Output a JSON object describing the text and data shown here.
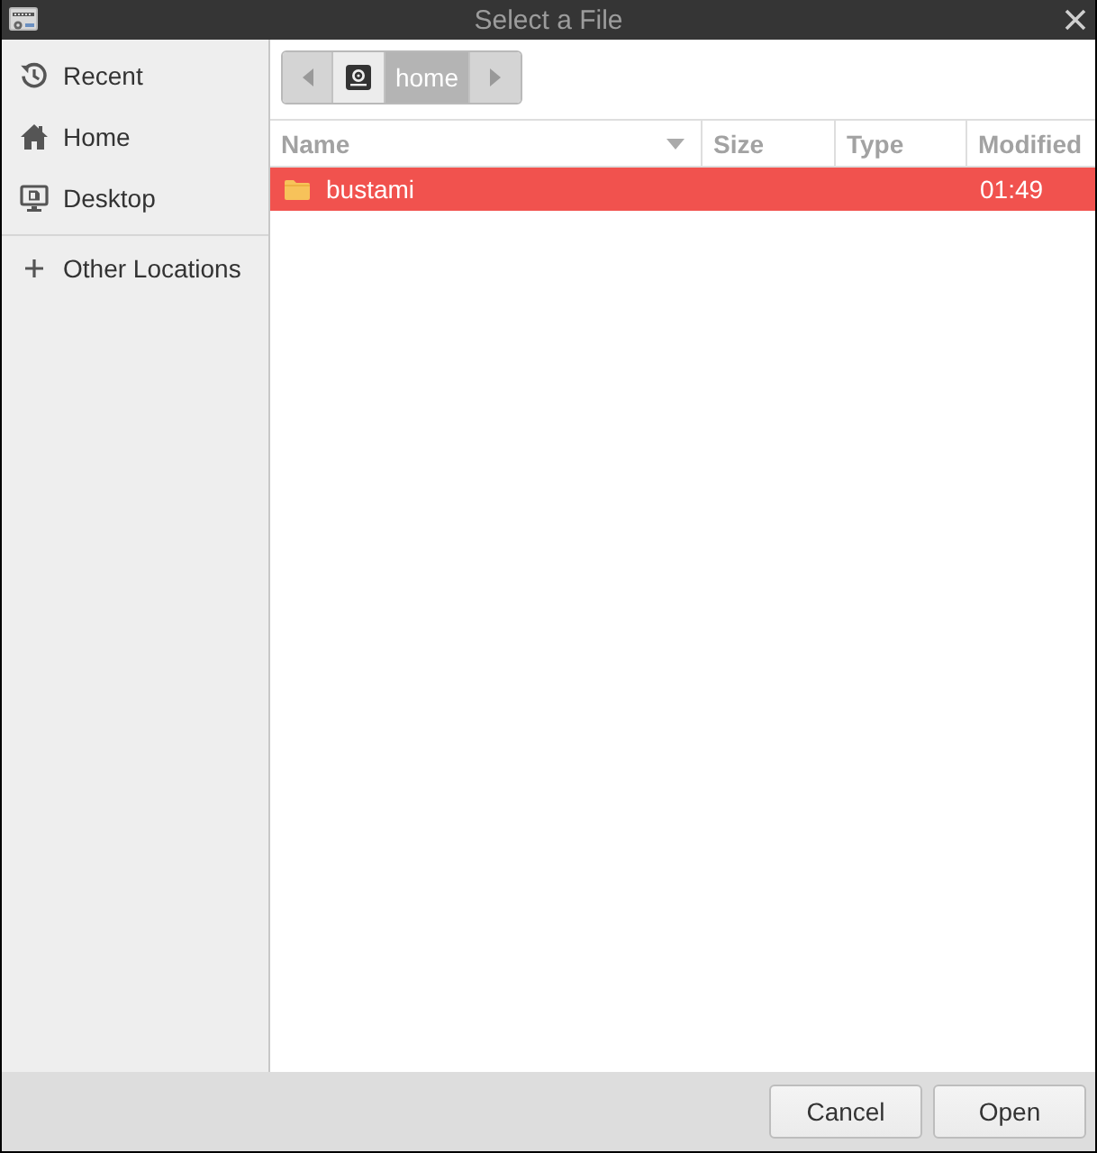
{
  "window": {
    "title": "Select a File"
  },
  "sidebar": {
    "items": [
      {
        "kind": "recent",
        "label": "Recent"
      },
      {
        "kind": "home",
        "label": "Home"
      },
      {
        "kind": "desktop",
        "label": "Desktop"
      },
      {
        "kind": "network",
        "label": "Other Locations"
      }
    ]
  },
  "path_bar": {
    "segments": [
      {
        "kind": "root",
        "selected": false
      },
      {
        "kind": "folder",
        "label": "home",
        "selected": true
      }
    ]
  },
  "table": {
    "columns": [
      {
        "label": "Name",
        "sorted": true
      },
      {
        "label": "Size",
        "sorted": false
      },
      {
        "label": "Type",
        "sorted": false
      },
      {
        "label": "Modified",
        "sorted": false
      }
    ],
    "rows": [
      {
        "kind": "folder",
        "name": "bustami",
        "modified": "01:49",
        "selected": true
      }
    ]
  },
  "buttons": [
    {
      "label": "Cancel"
    },
    {
      "label": "Open"
    }
  ]
}
